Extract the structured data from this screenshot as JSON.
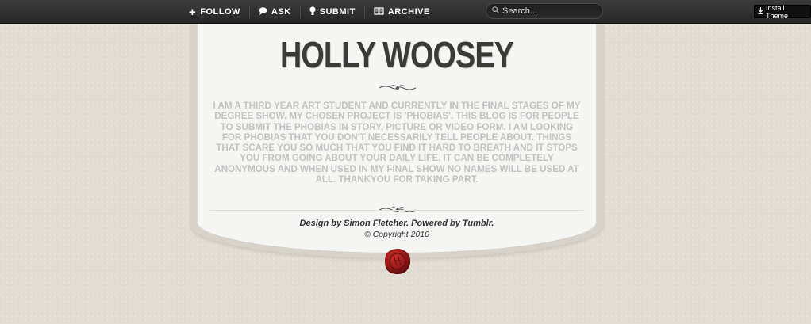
{
  "topbar": {
    "nav": [
      {
        "icon": "plus-icon",
        "glyph": "+",
        "label": "FOLLOW"
      },
      {
        "icon": "speech-bubble-icon",
        "glyph": "●",
        "label": "ASK"
      },
      {
        "icon": "lightbulb-icon",
        "glyph": "⚲",
        "label": "SUBMIT"
      },
      {
        "icon": "book-icon",
        "glyph": "▥",
        "label": "ARCHIVE"
      }
    ],
    "search": {
      "placeholder": "Search..."
    },
    "install_theme": "Install Theme"
  },
  "blog": {
    "title": "HOLLY WOOSEY",
    "description": "I AM A THIRD YEAR ART STUDENT AND CURRENTLY IN THE FINAL STAGES OF MY DEGREE SHOW. MY CHOSEN PROJECT IS 'PHOBIAS'. THIS BLOG IS FOR PEOPLE TO SUBMIT THE PHOBIAS IN STORY, PICTURE OR VIDEO FORM. I AM LOOKING FOR PHOBIAS THAT YOU DON'T NECESSARILY TELL PEOPLE ABOUT. THINGS THAT SCARE YOU SO MUCH THAT YOU FIND IT HARD TO BREATH AND IT STOPS YOU FROM GOING ABOUT YOUR DAILY LIFE. IT CAN BE COMPLETELY ANONYMOUS AND WHEN USED IN MY FINAL SHOW NO NAMES WILL BE USED AT ALL. THANKYOU FOR TAKING PART.",
    "credits": "Design by Simon Fletcher. Powered by Tumblr.",
    "copyright": "© Copyright 2010"
  },
  "colors": {
    "topbar": "#2f2f2f",
    "background": "#e2ddd4",
    "card": "#f5f5f4",
    "seal": "#9b1a1a"
  }
}
